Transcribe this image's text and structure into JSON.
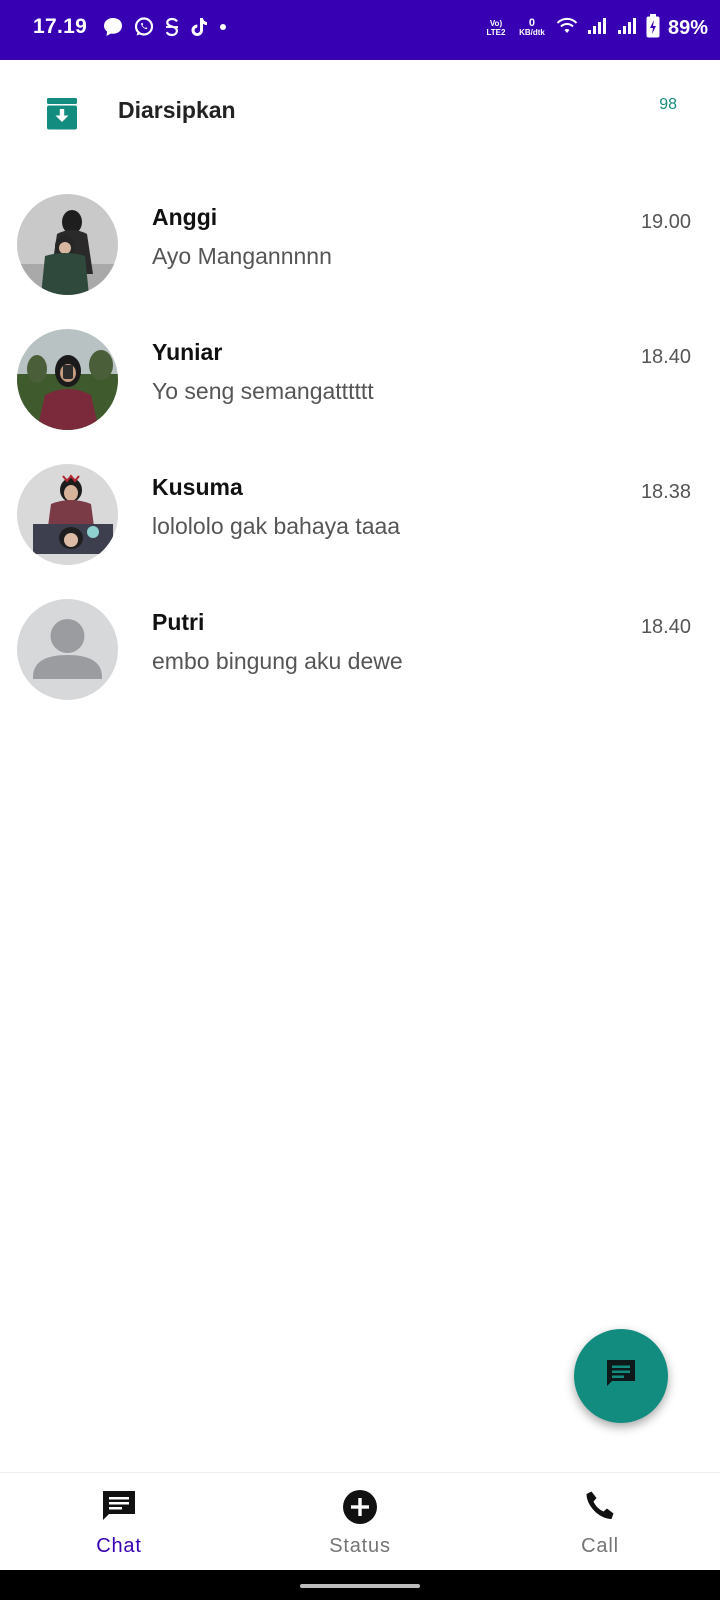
{
  "status_bar": {
    "time": "17.19",
    "network_top": "Vo) LTE2",
    "speed_value": "0",
    "speed_unit": "KB/dtk",
    "battery": "89%"
  },
  "archive": {
    "label": "Diarsipkan",
    "count": "98"
  },
  "chats": [
    {
      "name": "Anggi",
      "message": "Ayo Mangannnnn",
      "time": "19.00"
    },
    {
      "name": "Yuniar",
      "message": "Yo seng semangatttttt",
      "time": "18.40"
    },
    {
      "name": "Kusuma",
      "message": "lolololo gak bahaya taaa",
      "time": "18.38"
    },
    {
      "name": "Putri",
      "message": "embo bingung aku dewe",
      "time": "18.40"
    }
  ],
  "nav": {
    "chat": "Chat",
    "status": "Status",
    "call": "Call"
  },
  "colors": {
    "status_bar": "#3700b3",
    "accent": "#128c7e",
    "nav_active": "#3700b3"
  },
  "icons": [
    "message-icon",
    "whatsapp-icon",
    "s-icon",
    "tiktok-icon",
    "wifi-icon",
    "signal-icon",
    "battery-icon",
    "archive-icon",
    "new-chat-icon",
    "chat-icon",
    "status-add-icon",
    "phone-icon"
  ]
}
